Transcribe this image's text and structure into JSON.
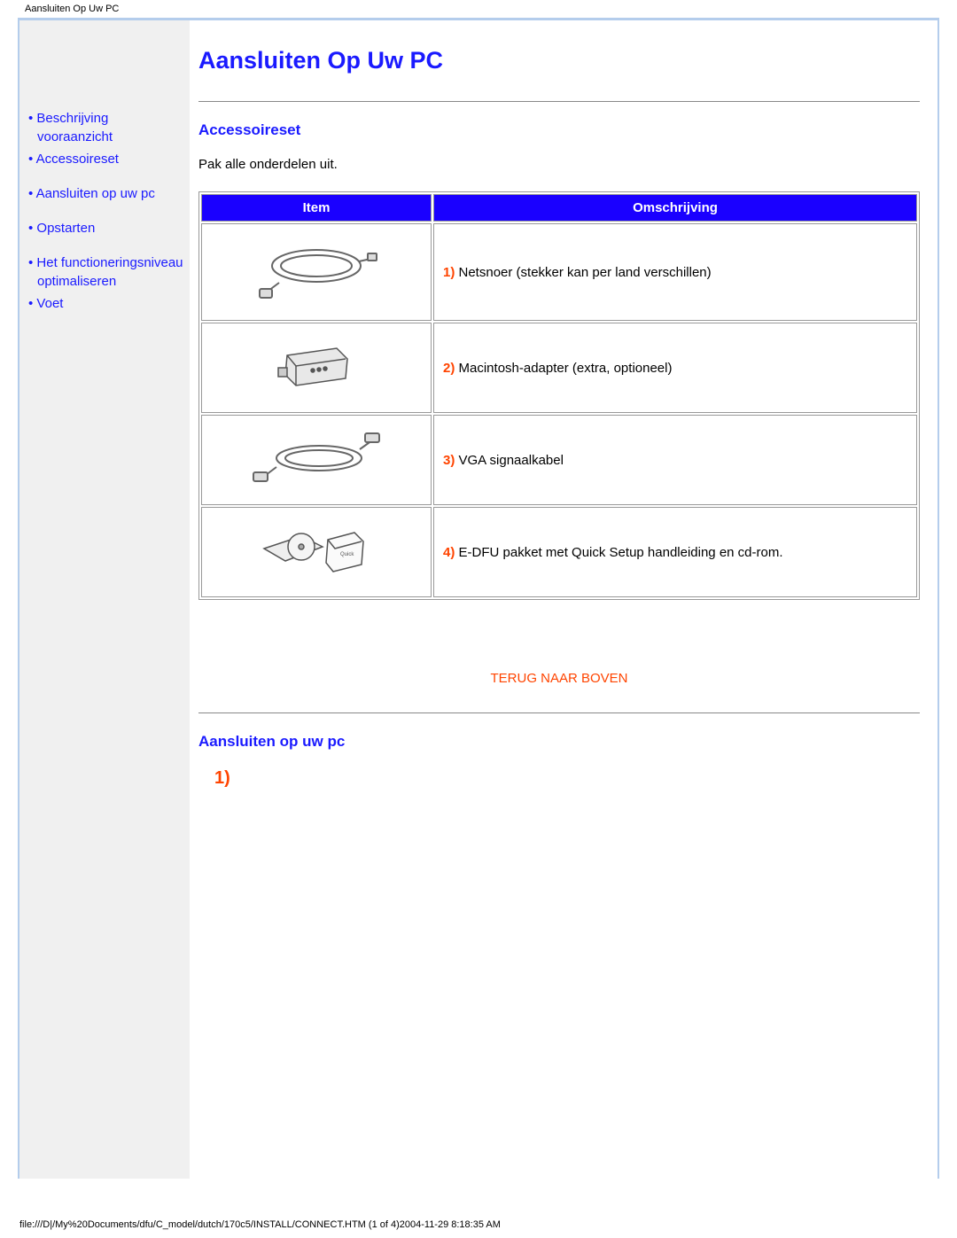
{
  "header_small_title": "Aansluiten Op Uw PC",
  "page_title": "Aansluiten Op Uw PC",
  "sidebar": {
    "items": [
      {
        "label": "Beschrijving vooraanzicht"
      },
      {
        "label": "Accessoireset"
      },
      {
        "label": "Aansluiten op uw pc"
      },
      {
        "label": "Opstarten"
      },
      {
        "label": "Het functioneringsniveau optimaliseren"
      },
      {
        "label": "Voet"
      }
    ]
  },
  "section1": {
    "title": "Accessoireset",
    "intro": "Pak alle onderdelen uit.",
    "table": {
      "head_item": "Item",
      "head_desc": "Omschrijving",
      "rows": [
        {
          "num": "1)",
          "desc": " Netsnoer (stekker kan per land verschillen)"
        },
        {
          "num": "2)",
          "desc": " Macintosh-adapter (extra, optioneel)"
        },
        {
          "num": "3)",
          "desc": " VGA signaalkabel"
        },
        {
          "num": "4)",
          "desc": " E-DFU pakket met Quick Setup handleiding en cd-rom."
        }
      ]
    }
  },
  "back_to_top": "TERUG NAAR BOVEN",
  "section2": {
    "title": "Aansluiten op uw pc",
    "step1": "1)"
  },
  "footer_path": "file:///D|/My%20Documents/dfu/C_model/dutch/170c5/INSTALL/CONNECT.HTM (1 of 4)2004-11-29 8:18:35 AM"
}
